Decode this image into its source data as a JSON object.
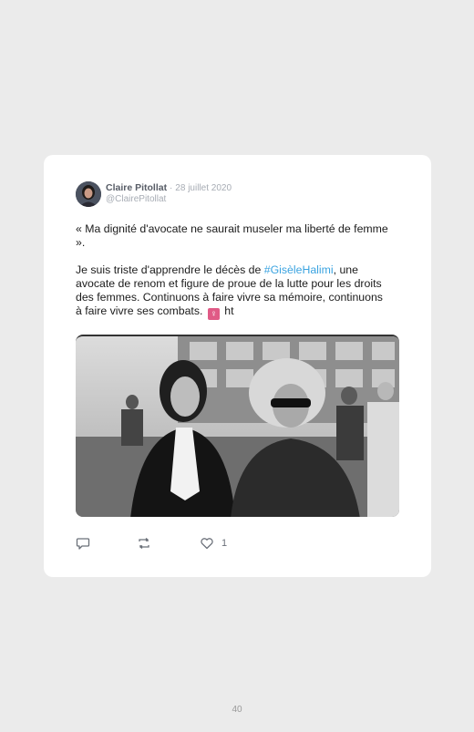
{
  "tweet": {
    "author_name": "Claire Pitollat",
    "separator": "·",
    "date": "28 juillet 2020",
    "handle": "@ClairePitollat",
    "quote": "« Ma dignité d'avocate ne saurait museler ma liberté de femme ».",
    "body_before": "Je suis triste d'apprendre le décès de",
    "hashtag": "#GisèleHalimi",
    "body_after": ", une avocate de renom et figure de proue de la lutte pour les droits des femmes. Continuons à faire vivre sa mémoire, continuons à faire vivre ses combats.",
    "emoji": "♀",
    "tail": "ht",
    "like_count": "1"
  },
  "icons": {
    "reply": "reply-icon",
    "retweet": "retweet-icon",
    "like": "heart-icon",
    "avatar": "avatar"
  },
  "page": {
    "number": "40"
  }
}
